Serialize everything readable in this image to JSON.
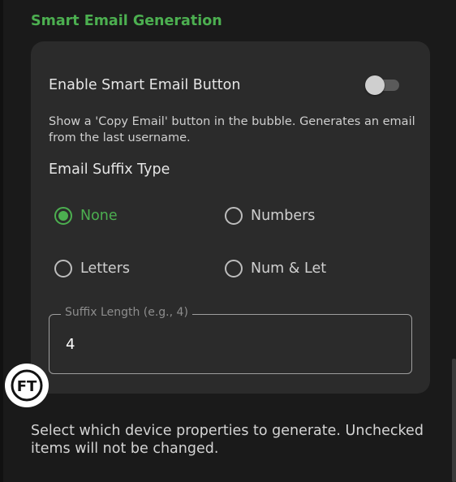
{
  "section": {
    "title": "Smart Email Generation"
  },
  "smart_email": {
    "enable_label": "Enable Smart Email Button",
    "enabled": false,
    "description": "Show a 'Copy Email' button in the bubble. Generates an email from the last username.",
    "suffix_type_label": "Email Suffix Type",
    "options": [
      {
        "label": "None",
        "checked": true
      },
      {
        "label": "Numbers",
        "checked": false
      },
      {
        "label": "Letters",
        "checked": false
      },
      {
        "label": "Num & Let",
        "checked": false
      }
    ],
    "suffix_length": {
      "label": "Suffix Length (e.g., 4)",
      "value": "4"
    }
  },
  "floating_button": {
    "logo_text": "FT"
  },
  "footer": {
    "text": "Select which device properties to generate. Unchecked items will not be changed."
  },
  "colors": {
    "accent": "#4caf50",
    "background": "#1a1a1a",
    "card": "#2b2b2b"
  }
}
